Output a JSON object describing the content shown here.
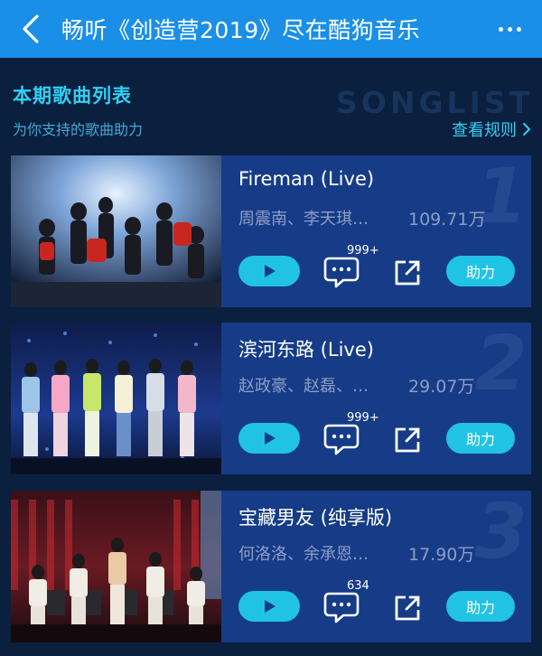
{
  "header": {
    "title": "畅听《创造营2019》尽在酷狗音乐"
  },
  "section": {
    "title": "本期歌曲列表",
    "subtitle": "为你支持的歌曲助力",
    "watermark": "SONGLIST",
    "rules_link": "查看规则"
  },
  "songs": [
    {
      "rank": "1",
      "title": "Fireman (Live)",
      "artists": "周震南、李天琪…",
      "votes": "109.71万",
      "comment_count": "999+",
      "help_label": "助力"
    },
    {
      "rank": "2",
      "title": "滨河东路 (Live)",
      "artists": "赵政豪、赵磊、…",
      "votes": "29.07万",
      "comment_count": "999+",
      "help_label": "助力"
    },
    {
      "rank": "3",
      "title": "宝藏男友 (纯享版)",
      "artists": "何洛洛、余承恩…",
      "votes": "17.90万",
      "comment_count": "634",
      "help_label": "助力"
    }
  ],
  "colors": {
    "topbar": "#1a8fe8",
    "background": "#0b1f3e",
    "card": "#163c87",
    "accent": "#21c3e4"
  }
}
